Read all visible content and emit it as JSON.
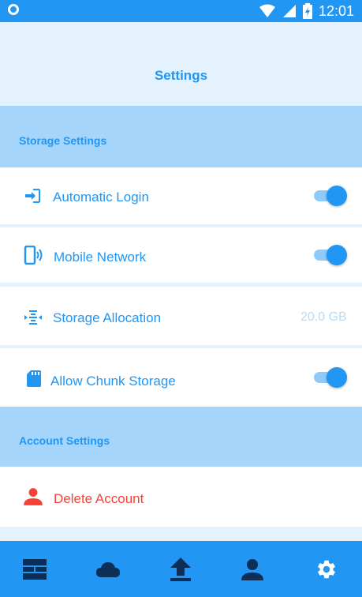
{
  "status_bar": {
    "time": "12:01"
  },
  "header": {
    "title": "Settings"
  },
  "storage_settings": {
    "section_label": "Storage Settings",
    "automatic_login": {
      "label": "Automatic Login",
      "enabled": true,
      "icon": "login-icon"
    },
    "mobile_network": {
      "label": "Mobile Network",
      "enabled": true,
      "icon": "mobile-network-icon"
    },
    "storage_allocation": {
      "label": "Storage Allocation",
      "value": "20.0 GB",
      "icon": "storage-allocation-icon"
    },
    "allow_chunk_storage": {
      "label": "Allow Chunk Storage",
      "enabled": true,
      "icon": "sd-card-icon"
    }
  },
  "account_settings": {
    "section_label": "Account Settings",
    "delete_account": {
      "label": "Delete Account",
      "icon": "person-icon"
    }
  },
  "bottom_nav": {
    "items": [
      "dashboard-icon",
      "cloud-icon",
      "upload-icon",
      "account-icon",
      "settings-gear-icon"
    ]
  },
  "colors": {
    "primary": "#2196f3",
    "section_bg": "#a6d5fb",
    "page_bg": "#e3f2fd",
    "danger": "#f44336",
    "muted_value": "#b3dcf9"
  }
}
